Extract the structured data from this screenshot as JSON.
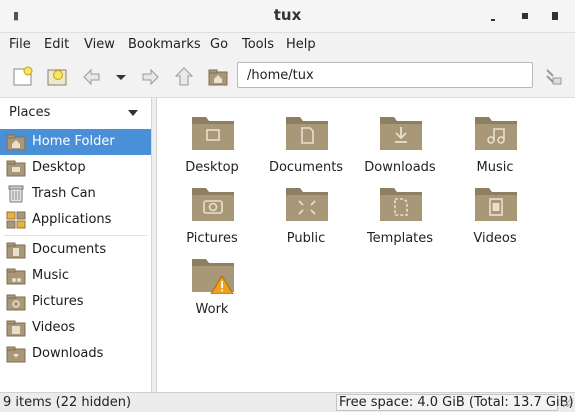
{
  "window": {
    "title": "tux",
    "menu_glyph": "▮"
  },
  "menu": [
    "File",
    "Edit",
    "View",
    "Bookmarks",
    "Go",
    "Tools",
    "Help"
  ],
  "toolbar": {
    "location": "/home/tux",
    "icons": [
      "new-window-icon",
      "new-tab-icon",
      "back-icon",
      "back-dropdown-icon",
      "forward-icon",
      "up-icon",
      "home-icon",
      "go-icon"
    ]
  },
  "sidebar": {
    "header": "Places",
    "items": [
      {
        "label": "Home Folder",
        "icon": "home-folder-icon",
        "selected": true
      },
      {
        "label": "Desktop",
        "icon": "desktop-icon"
      },
      {
        "label": "Trash Can",
        "icon": "trash-icon"
      },
      {
        "label": "Applications",
        "icon": "applications-icon"
      },
      {
        "label": "Documents",
        "icon": "documents-folder-icon"
      },
      {
        "label": "Music",
        "icon": "music-folder-icon"
      },
      {
        "label": "Pictures",
        "icon": "pictures-folder-icon"
      },
      {
        "label": "Videos",
        "icon": "videos-folder-icon"
      },
      {
        "label": "Downloads",
        "icon": "downloads-folder-icon"
      }
    ]
  },
  "files": [
    {
      "name": "Desktop",
      "emblem": "desktop"
    },
    {
      "name": "Documents",
      "emblem": "documents"
    },
    {
      "name": "Downloads",
      "emblem": "downloads"
    },
    {
      "name": "Music",
      "emblem": "music"
    },
    {
      "name": "Pictures",
      "emblem": "pictures"
    },
    {
      "name": "Public",
      "emblem": "public"
    },
    {
      "name": "Templates",
      "emblem": "templates"
    },
    {
      "name": "Videos",
      "emblem": "videos"
    },
    {
      "name": "Work",
      "emblem": "warning"
    }
  ],
  "status": {
    "items": "9 items (22 hidden)",
    "free_space": "Free space: 4.0 GiB (Total: 13.7 GiB)"
  },
  "colors": {
    "folder": "#a89878",
    "folder_dark": "#8e7f63",
    "selection": "#4a90d9",
    "warning": "#f0a020"
  }
}
